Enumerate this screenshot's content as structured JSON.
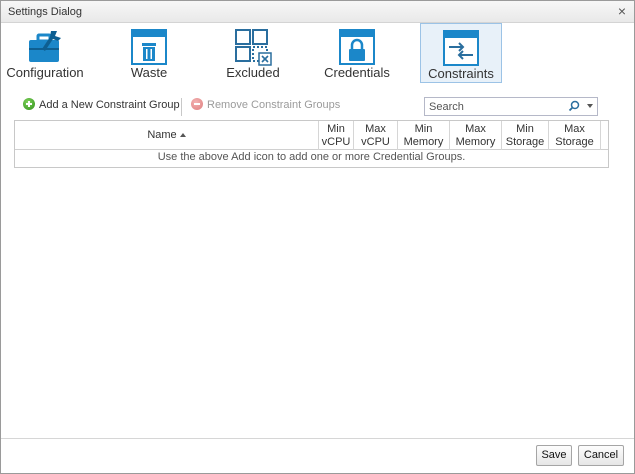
{
  "dialog": {
    "title": "Settings Dialog",
    "close_glyph": "×"
  },
  "nav": {
    "items": [
      {
        "label": "Configuration",
        "icon": "briefcase-wrench-icon"
      },
      {
        "label": "Waste",
        "icon": "trash-window-icon"
      },
      {
        "label": "Excluded",
        "icon": "grid-excluded-icon"
      },
      {
        "label": "Credentials",
        "icon": "lock-window-icon"
      },
      {
        "label": "Constraints",
        "icon": "arrows-window-icon"
      }
    ],
    "active": "Constraints"
  },
  "toolbar": {
    "add_label": "Add a New Constraint Group",
    "remove_label": "Remove Constraint Groups",
    "search_placeholder": "Search"
  },
  "grid": {
    "columns": [
      {
        "line1": "Name",
        "line2": ""
      },
      {
        "line1": "Min",
        "line2": "vCPU"
      },
      {
        "line1": "Max",
        "line2": "vCPU"
      },
      {
        "line1": "Min",
        "line2": "Memory"
      },
      {
        "line1": "Max",
        "line2": "Memory"
      },
      {
        "line1": "Min",
        "line2": "Storage"
      },
      {
        "line1": "Max",
        "line2": "Storage"
      }
    ],
    "empty_message": "Use the above Add icon to add one or more Credential Groups."
  },
  "footer": {
    "save_label": "Save",
    "cancel_label": "Cancel"
  },
  "colors": {
    "accent": "#1b87c9",
    "icon_dark": "#2a6e9e",
    "active_bg": "#e8f1f9",
    "active_border": "#9cc3e6"
  }
}
